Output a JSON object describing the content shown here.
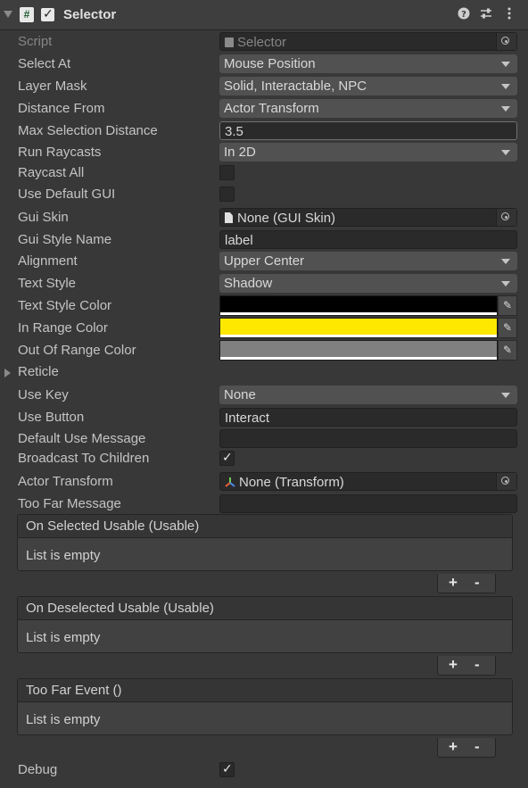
{
  "header": {
    "title": "Selector",
    "script_icon": "#",
    "enabled": true
  },
  "fields": {
    "script": {
      "label": "Script",
      "value": "Selector"
    },
    "select_at": {
      "label": "Select At",
      "value": "Mouse Position"
    },
    "layer_mask": {
      "label": "Layer Mask",
      "value": "Solid, Interactable, NPC"
    },
    "distance_from": {
      "label": "Distance From",
      "value": "Actor Transform"
    },
    "max_selection_distance": {
      "label": "Max Selection Distance",
      "value": "3.5"
    },
    "run_raycasts": {
      "label": "Run Raycasts",
      "value": "In 2D"
    },
    "raycast_all": {
      "label": "Raycast All",
      "checked": false
    },
    "use_default_gui": {
      "label": "Use Default GUI",
      "checked": false
    },
    "gui_skin": {
      "label": "Gui Skin",
      "value": "None (GUI Skin)"
    },
    "gui_style_name": {
      "label": "Gui Style Name",
      "value": "label"
    },
    "alignment": {
      "label": "Alignment",
      "value": "Upper Center"
    },
    "text_style": {
      "label": "Text Style",
      "value": "Shadow"
    },
    "text_style_color": {
      "label": "Text Style Color",
      "color": "#000000"
    },
    "in_range_color": {
      "label": "In Range Color",
      "color": "#ffe800"
    },
    "out_of_range_color": {
      "label": "Out Of Range Color",
      "color": "#808080"
    },
    "reticle": {
      "label": "Reticle"
    },
    "use_key": {
      "label": "Use Key",
      "value": "None"
    },
    "use_button": {
      "label": "Use Button",
      "value": "Interact"
    },
    "default_use_message": {
      "label": "Default Use Message",
      "value": ""
    },
    "broadcast_to_children": {
      "label": "Broadcast To Children",
      "checked": true
    },
    "actor_transform": {
      "label": "Actor Transform",
      "value": "None (Transform)"
    },
    "too_far_message": {
      "label": "Too Far Message",
      "value": ""
    },
    "debug": {
      "label": "Debug",
      "checked": true
    }
  },
  "events": [
    {
      "title": "On Selected Usable (Usable)",
      "empty": "List is empty"
    },
    {
      "title": "On Deselected Usable (Usable)",
      "empty": "List is empty"
    },
    {
      "title": "Too Far Event ()",
      "empty": "List is empty"
    }
  ],
  "list_buttons": {
    "add": "+",
    "remove": "-"
  },
  "icons": [
    "foldout-arrow-icon",
    "script-icon",
    "checkbox-icon",
    "help-icon",
    "preset-icon",
    "kebab-menu-icon",
    "dropdown-arrow-icon",
    "object-picker-icon",
    "eyedropper-icon",
    "file-icon",
    "transform-icon"
  ]
}
